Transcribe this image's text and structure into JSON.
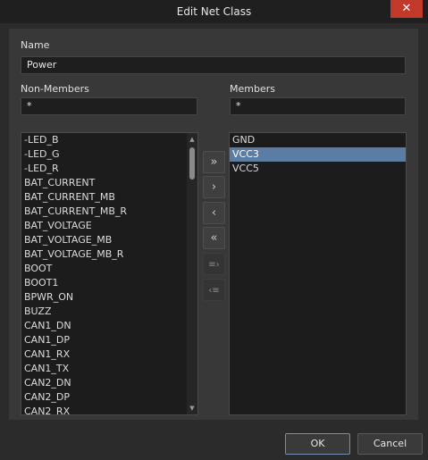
{
  "window": {
    "title": "Edit Net Class",
    "close_glyph": "✕"
  },
  "name": {
    "label": "Name",
    "value": "Power"
  },
  "non_members": {
    "label": "Non-Members",
    "filter": "*",
    "items": [
      "-LED_B",
      "-LED_G",
      "-LED_R",
      "BAT_CURRENT",
      "BAT_CURRENT_MB",
      "BAT_CURRENT_MB_R",
      "BAT_VOLTAGE",
      "BAT_VOLTAGE_MB",
      "BAT_VOLTAGE_MB_R",
      "BOOT",
      "BOOT1",
      "BPWR_ON",
      "BUZZ",
      "CAN1_DN",
      "CAN1_DP",
      "CAN1_RX",
      "CAN1_TX",
      "CAN2_DN",
      "CAN2_DP",
      "CAN2_RX"
    ]
  },
  "members": {
    "label": "Members",
    "filter": "*",
    "items": [
      "GND",
      "VCC3",
      "VCC5"
    ],
    "selected": "VCC3"
  },
  "transfer_buttons": {
    "add_all": "»",
    "add": "›",
    "remove": "‹",
    "remove_all": "«",
    "add_filtered": "≡›",
    "remove_filtered": "‹≡"
  },
  "scrollbar": {
    "up": "▲",
    "down": "▼"
  },
  "footer": {
    "ok": "OK",
    "cancel": "Cancel"
  }
}
